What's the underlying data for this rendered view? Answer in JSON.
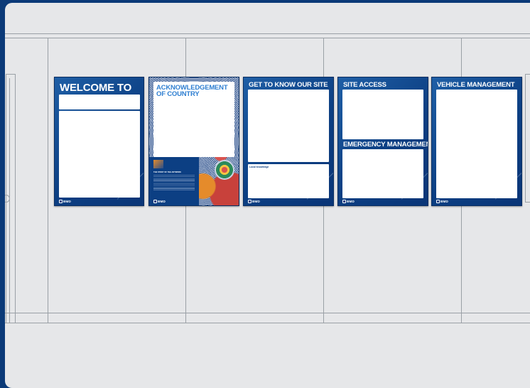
{
  "panels": [
    {
      "title": "WELCOME TO",
      "logo": "BMD"
    },
    {
      "title_line1": "ACKNOWLEDGEMENT",
      "title_line2": "OF COUNTRY",
      "caption": "THE STORY OF THE ARTWORK",
      "logo": "BMD"
    },
    {
      "title": "GET TO KNOW OUR SITE",
      "box_label": "Local knowledge",
      "logo": "BMD"
    },
    {
      "title": "SITE ACCESS",
      "title2": "EMERGENCY MANAGEMENT",
      "logo": "BMD"
    },
    {
      "title": "VEHICLE MANAGEMENT",
      "logo": "BMD"
    }
  ],
  "colors": {
    "panel_blue": "#0c3f83",
    "background": "#e6e7e9",
    "frame": "#0b3a78",
    "accent_blue": "#2f7fd1"
  }
}
